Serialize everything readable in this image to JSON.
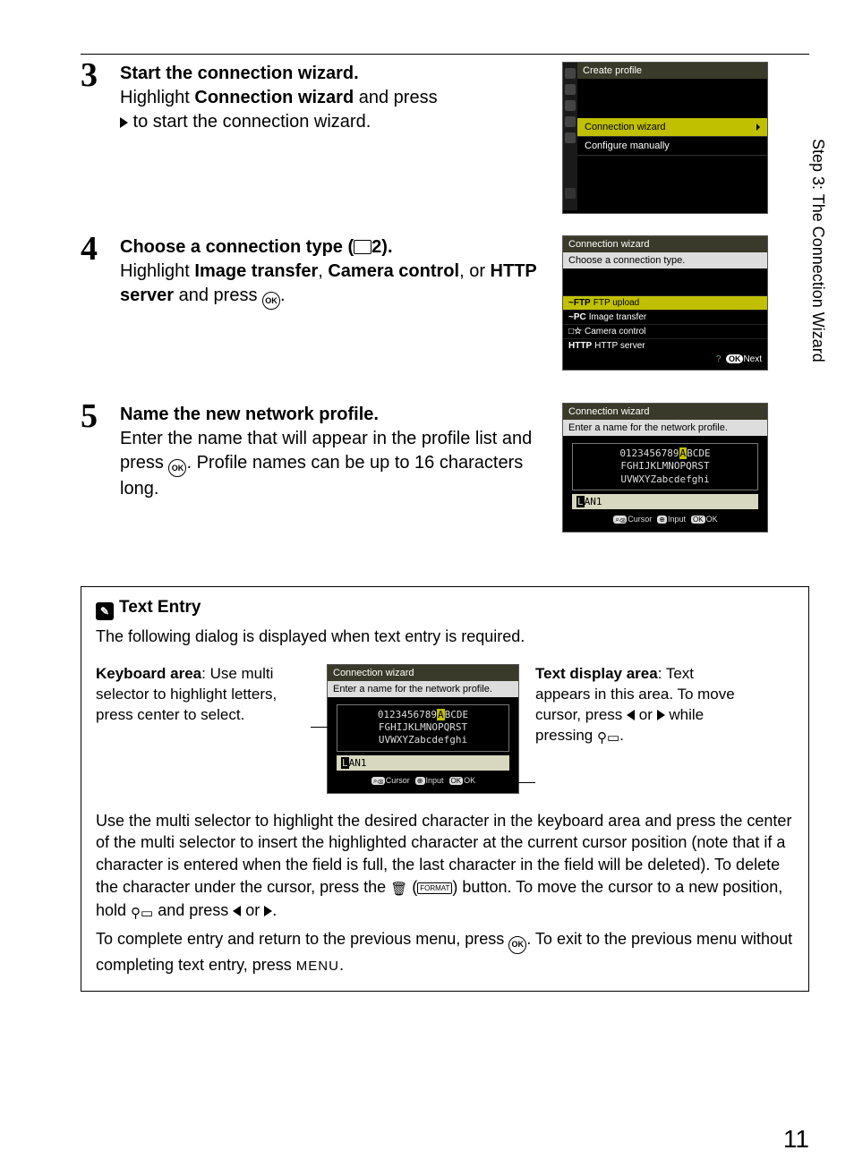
{
  "side_label": "Step 3: The Connection Wizard",
  "page_number": "11",
  "steps": {
    "s3": {
      "num": "3",
      "title": "Start the connection wizard.",
      "line1a": "Highlight ",
      "line1b": "Connection wizard",
      "line1c": " and press ",
      "line2": " to start the connection wizard."
    },
    "s4": {
      "num": "4",
      "title_a": "Choose a connection type (",
      "title_b": "2",
      "title_c": ").",
      "line1a": "Highlight ",
      "line1b": "Image transfer",
      "line1c": ", ",
      "line1d": "Camera control",
      "line1e": ", or ",
      "line1f": "HTTP server",
      "line1g": " and press "
    },
    "s5": {
      "num": "5",
      "title": "Name the new network profile.",
      "body_a": "Enter the name that will appear in the profile list and press ",
      "body_b": ". Profile names can be up to 16 characters long."
    }
  },
  "cam1": {
    "header": "Create profile",
    "row_hl": "Connection wizard",
    "row2": "Configure manually"
  },
  "cam2": {
    "header": "Connection wizard",
    "sub": "Choose a connection type.",
    "items": [
      {
        "pre": "~FTP",
        "label": "FTP upload"
      },
      {
        "pre": "~PC",
        "label": "Image transfer"
      },
      {
        "pre": "□☆",
        "label": "Camera control"
      },
      {
        "pre": "HTTP",
        "label": "HTTP server"
      }
    ],
    "next": "Next"
  },
  "cam3": {
    "header": "Connection wizard",
    "sub": "Enter a name for the network profile.",
    "kbd_l1_a": "0123456789",
    "kbd_l1_hl": "A",
    "kbd_l1_b": "BCDE",
    "kbd_l2": "FGHIJKLMNOPQRST",
    "kbd_l3": "UVWXYZabcdefghi",
    "name_pre": "L",
    "name_val": "AN1",
    "footer_cursor": "Cursor",
    "footer_input": "Input",
    "footer_ok": "OK"
  },
  "info": {
    "title": "Text Entry",
    "intro": "The following dialog is displayed when text entry is required.",
    "left_label": "Keyboard area",
    "left_text": ": Use multi selector to highlight letters, press center to select.",
    "right_label": "Text display area",
    "right_text_a": ": Text appears in this area. To move cursor, press ",
    "right_text_b": " or ",
    "right_text_c": " while pressing ",
    "right_text_d": ".",
    "para1_a": "Use the multi selector to highlight the desired character in the keyboard area and press the center of the multi selector to insert the highlighted character at the current cursor position (note that if a character is entered when the field is full, the last character in the field will be deleted). To delete the character under the cursor, press the ",
    "para1_b": " button. To move the cursor to a new position, hold ",
    "para1_c": " and press ",
    "para1_d": " or ",
    "para1_e": ".",
    "para2_a": "To complete entry and return to the previous menu, press ",
    "para2_b": ". To exit to the previous menu without completing text entry, press ",
    "para2_c": ".",
    "menu": "MENU",
    "format": "FORMAT"
  }
}
